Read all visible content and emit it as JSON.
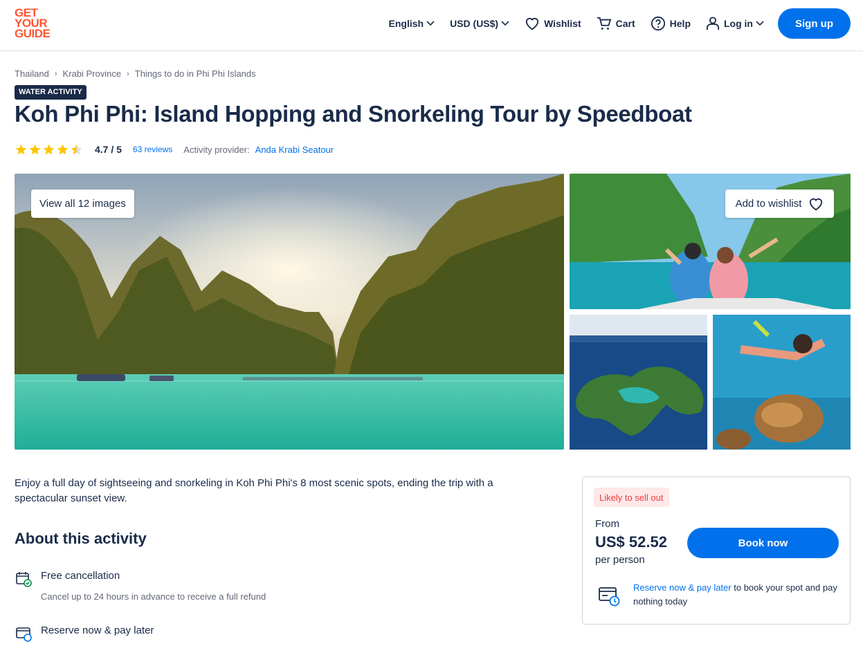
{
  "header": {
    "logo_lines": [
      "GET",
      "YOUR",
      "GUIDE"
    ],
    "language": "English",
    "currency": "USD (US$)",
    "wishlist": "Wishlist",
    "cart": "Cart",
    "help": "Help",
    "login": "Log in",
    "signup": "Sign up",
    "brand_color": "#ff5533",
    "accent_color": "#0071eb"
  },
  "breadcrumb": [
    "Thailand",
    "Krabi Province",
    "Things to do in Phi Phi Islands"
  ],
  "badge": "WATER ACTIVITY",
  "title": "Koh Phi Phi: Island Hopping and Snorkeling Tour by Speedboat",
  "rating": {
    "stars": 4.5,
    "value": "4.7 / 5",
    "reviews": "63 reviews",
    "provider_label": "Activity provider:",
    "provider": "Anda Krabi Seatour"
  },
  "gallery": {
    "view_all": "View all 12 images",
    "add_to_wishlist": "Add to wishlist"
  },
  "intro": "Enjoy a full day of sightseeing and snorkeling in Koh Phi Phi's 8 most scenic spots, ending the trip with a spectacular sunset view.",
  "about": {
    "heading": "About this activity",
    "features": [
      {
        "icon": "calendar-check-icon",
        "title": "Free cancellation",
        "desc": "Cancel up to 24 hours in advance to receive a full refund"
      },
      {
        "icon": "card-clock-icon",
        "title": "Reserve now & pay later",
        "desc": ""
      }
    ]
  },
  "booking": {
    "likely_sell_out": "Likely to sell out",
    "from": "From",
    "price": "US$ 52.52",
    "per_person": "per person",
    "book_now": "Book now",
    "reserve_link": "Reserve now & pay later",
    "reserve_text": " to book your spot and pay nothing today"
  }
}
